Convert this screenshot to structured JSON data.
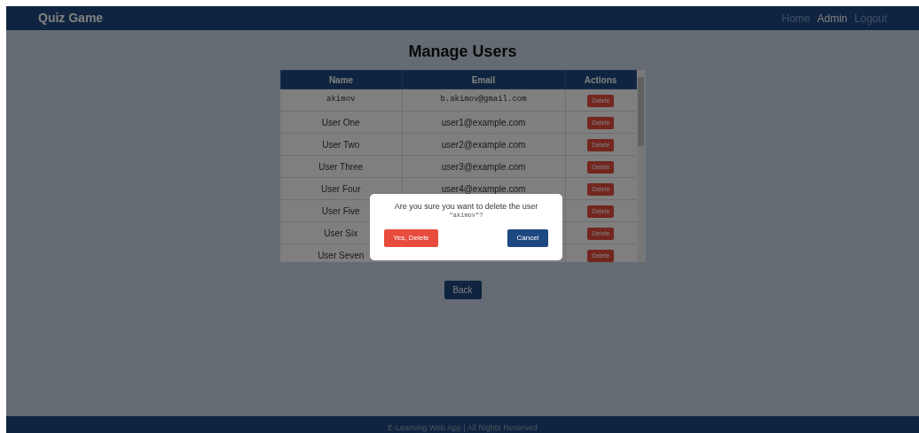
{
  "navbar": {
    "brand": "Quiz Game",
    "links": [
      {
        "label": "Home",
        "selected": false
      },
      {
        "label": "Admin",
        "selected": true
      },
      {
        "label": "Logout",
        "selected": false
      }
    ]
  },
  "page_title": "Manage Users",
  "table": {
    "columns": [
      "Name",
      "Email",
      "Actions"
    ],
    "rows": [
      {
        "name": "akimov",
        "email": "b.akimov@gmail.com",
        "action": "Delete",
        "mono": true
      },
      {
        "name": "User One",
        "email": "user1@example.com",
        "action": "Delete",
        "mono": false
      },
      {
        "name": "User Two",
        "email": "user2@example.com",
        "action": "Delete",
        "mono": false
      },
      {
        "name": "User Three",
        "email": "user3@example.com",
        "action": "Delete",
        "mono": false
      },
      {
        "name": "User Four",
        "email": "user4@example.com",
        "action": "Delete",
        "mono": false
      },
      {
        "name": "User Five",
        "email": "",
        "action": "Delete",
        "mono": false
      },
      {
        "name": "User Six",
        "email": "",
        "action": "Delete",
        "mono": false
      },
      {
        "name": "User Seven",
        "email": "",
        "action": "Delete",
        "mono": false
      }
    ]
  },
  "back_button": "Back",
  "dialog": {
    "message": "Are you sure you want to delete the user",
    "user": "\"akimov\"?",
    "confirm": "Yes, Delete",
    "cancel": "Cancel"
  },
  "footer": "E-Learning Web App | All Rights Reserved"
}
